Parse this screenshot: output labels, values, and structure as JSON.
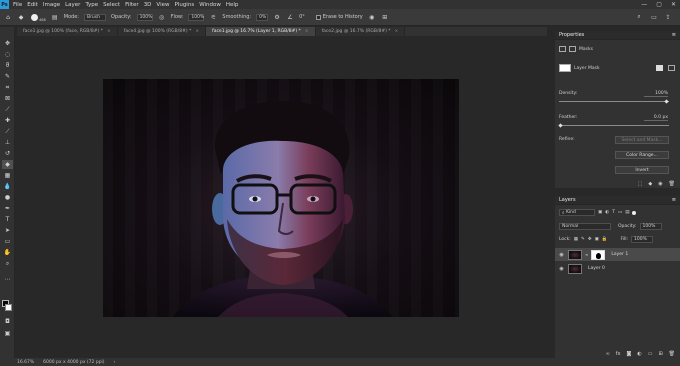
{
  "app": {
    "logo": "Ps"
  },
  "menu": [
    "File",
    "Edit",
    "Image",
    "Layer",
    "Type",
    "Select",
    "Filter",
    "3D",
    "View",
    "Plugins",
    "Window",
    "Help"
  ],
  "window_controls": {
    "minimize": "—",
    "maximize": "▢",
    "close": "✕"
  },
  "options": {
    "brush_size": "468",
    "mode_label": "Mode:",
    "mode_value": "Brush",
    "opacity_label": "Opacity:",
    "opacity_value": "100%",
    "flow_label": "Flow:",
    "flow_value": "100%",
    "smoothing_label": "Smoothing:",
    "smoothing_value": "0%",
    "angle_value": "0°",
    "erase_history_label": "Erase to History"
  },
  "tabs": [
    {
      "label": "face1.jpg @ 100% (face, RGB/8#) *",
      "close": "×"
    },
    {
      "label": "face4.jpg @ 100% (RGB/8#) *",
      "close": "×"
    },
    {
      "label": "face1.jpg @ 16.7% (Layer 1, RGB/8#) *",
      "close": "×"
    },
    {
      "label": "face2.jpg @ 16.7% (RGB/8#) *",
      "close": "×"
    }
  ],
  "status": {
    "zoom": "16.67%",
    "doc_size": "6000 px x 4000 px (72 ppi)",
    "arrow": "›"
  },
  "properties": {
    "title": "Properties",
    "menu_icon": "≡",
    "masks_label": "Masks",
    "layer_mask_label": "Layer Mask",
    "density_label": "Density:",
    "density_value": "100%",
    "feather_label": "Feather:",
    "feather_value": "0.0 px",
    "refine_label": "Refine:",
    "select_mask_button": "Select and Mask...",
    "color_range_button": "Color Range...",
    "invert_button": "Invert"
  },
  "layers": {
    "title": "Layers",
    "menu_icon": "≡",
    "kind_value": "Kind",
    "blend_mode": "Normal",
    "opacity_label": "Opacity:",
    "opacity_value": "100%",
    "lock_label": "Lock:",
    "fill_label": "Fill:",
    "fill_value": "100%",
    "items": [
      {
        "name": "Layer 1",
        "selected": true
      },
      {
        "name": "Layer 0",
        "selected": false
      }
    ],
    "footer_fx": "fx"
  }
}
